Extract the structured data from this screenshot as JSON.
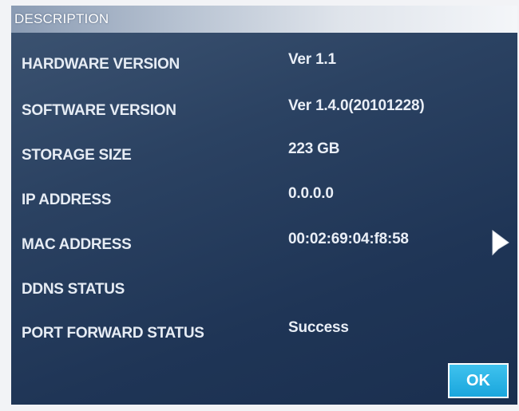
{
  "dialog": {
    "title": "DESCRIPTION",
    "rows": [
      {
        "label": "HARDWARE VERSION",
        "value": "Ver 1.1"
      },
      {
        "label": "SOFTWARE VERSION",
        "value": "Ver 1.4.0(20101228)"
      },
      {
        "label": "STORAGE SIZE",
        "value": "223 GB"
      },
      {
        "label": "IP ADDRESS",
        "value": "0.0.0.0"
      },
      {
        "label": "MAC ADDRESS",
        "value": "00:02:69:04:f8:58"
      },
      {
        "label": "DDNS STATUS",
        "value": ""
      },
      {
        "label": "PORT FORWARD STATUS",
        "value": "Success"
      }
    ],
    "ok_label": "OK"
  },
  "colors": {
    "background": "#1f3556",
    "header": "#dfe4eb",
    "ok_button": "#1aa6dd",
    "text": "#e6ecf4"
  },
  "icons": {
    "cursor": "mouse-pointer-icon"
  }
}
